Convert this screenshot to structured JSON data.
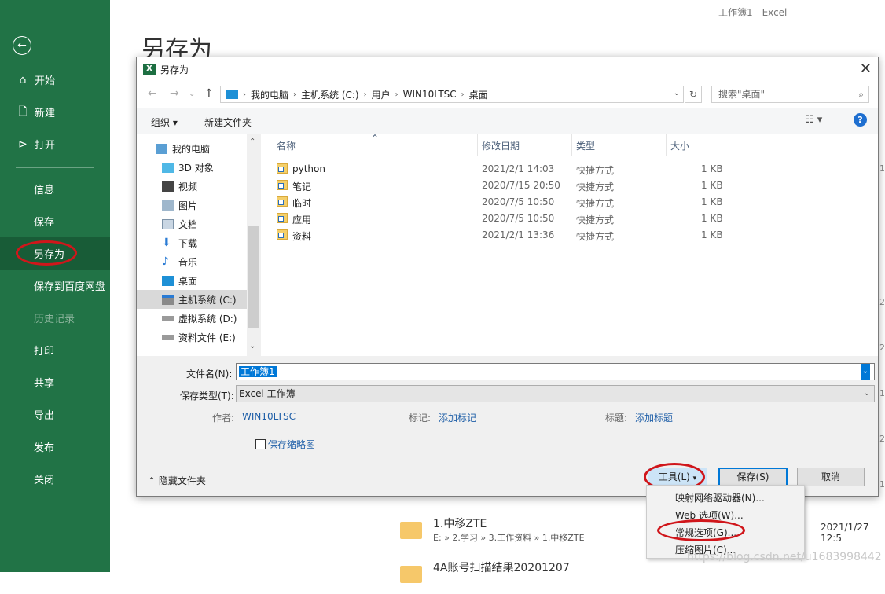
{
  "window": {
    "caption": "工作簿1  -  Excel"
  },
  "sidebar": {
    "items": [
      {
        "label": "开始",
        "icon": "home-icon"
      },
      {
        "label": "新建",
        "icon": "new-doc-icon"
      },
      {
        "label": "打开",
        "icon": "folder-open-icon"
      },
      {
        "label": "信息"
      },
      {
        "label": "保存"
      },
      {
        "label": "另存为",
        "active": true
      },
      {
        "label": "保存到百度网盘"
      },
      {
        "label": "历史记录",
        "disabled": true
      },
      {
        "label": "打印"
      },
      {
        "label": "共享"
      },
      {
        "label": "导出"
      },
      {
        "label": "发布"
      },
      {
        "label": "关闭"
      }
    ]
  },
  "backstage": {
    "title": "另存为",
    "recent": [
      {
        "name": "1.中移ZTE",
        "path": "E: » 2.学习 » 3.工作资料 » 1.中移ZTE",
        "date": "2021/1/27 12:5"
      },
      {
        "name": "4A账号扫描结果20201207"
      }
    ],
    "edge_numbers": [
      "1",
      "2",
      "2",
      "1",
      "2",
      "1"
    ]
  },
  "dialog": {
    "title": "另存为",
    "address": {
      "crumbs": [
        "我的电脑",
        "主机系统 (C:)",
        "用户",
        "WIN10LTSC",
        "桌面"
      ]
    },
    "search_placeholder": "搜索\"桌面\"",
    "toolbar": {
      "organize": "组织 ▾",
      "new_folder": "新建文件夹"
    },
    "nav_tree": [
      {
        "label": "我的电脑",
        "icon": "pc-icon"
      },
      {
        "label": "3D 对象",
        "icon": "3d-objects-icon"
      },
      {
        "label": "视频",
        "icon": "video-icon"
      },
      {
        "label": "图片",
        "icon": "picture-icon"
      },
      {
        "label": "文档",
        "icon": "document-icon"
      },
      {
        "label": "下载",
        "icon": "download-icon"
      },
      {
        "label": "音乐",
        "icon": "music-icon"
      },
      {
        "label": "桌面",
        "icon": "desktop-icon"
      },
      {
        "label": "主机系统 (C:)",
        "icon": "windows-drive-icon",
        "selected": true
      },
      {
        "label": "虚拟系统 (D:)",
        "icon": "drive-icon"
      },
      {
        "label": "资料文件 (E:)",
        "icon": "drive-icon"
      }
    ],
    "columns": {
      "name": "名称",
      "date": "修改日期",
      "type": "类型",
      "size": "大小"
    },
    "files": [
      {
        "name": "python",
        "date": "2021/2/1 14:03",
        "type": "快捷方式",
        "size": "1 KB"
      },
      {
        "name": "笔记",
        "date": "2020/7/15 20:50",
        "type": "快捷方式",
        "size": "1 KB"
      },
      {
        "name": "临时",
        "date": "2020/7/5 10:50",
        "type": "快捷方式",
        "size": "1 KB"
      },
      {
        "name": "应用",
        "date": "2020/7/5 10:50",
        "type": "快捷方式",
        "size": "1 KB"
      },
      {
        "name": "资料",
        "date": "2021/2/1 13:36",
        "type": "快捷方式",
        "size": "1 KB"
      }
    ],
    "filename_label": "文件名(N):",
    "filename_value": "工作簿1",
    "filetype_label": "保存类型(T):",
    "filetype_value": "Excel 工作簿",
    "author_label": "作者:",
    "author_value": "WIN10LTSC",
    "tags_label": "标记:",
    "tags_value": "添加标记",
    "title_label": "标题:",
    "title_value": "添加标题",
    "thumbnail_label": "保存缩略图",
    "hide_folders": "隐藏文件夹",
    "buttons": {
      "tools": "工具(L)",
      "save": "保存(S)",
      "cancel": "取消"
    }
  },
  "tools_menu": {
    "items": [
      "映射网络驱动器(N)...",
      "Web 选项(W)...",
      "常规选项(G)...",
      "压缩图片(C)..."
    ]
  },
  "watermark": "https://blog.csdn.net/u1683998442",
  "colors": {
    "excel_green": "#217346",
    "active_green": "#185c37",
    "highlight_red": "#d0161b",
    "accent_blue": "#0078d7"
  }
}
